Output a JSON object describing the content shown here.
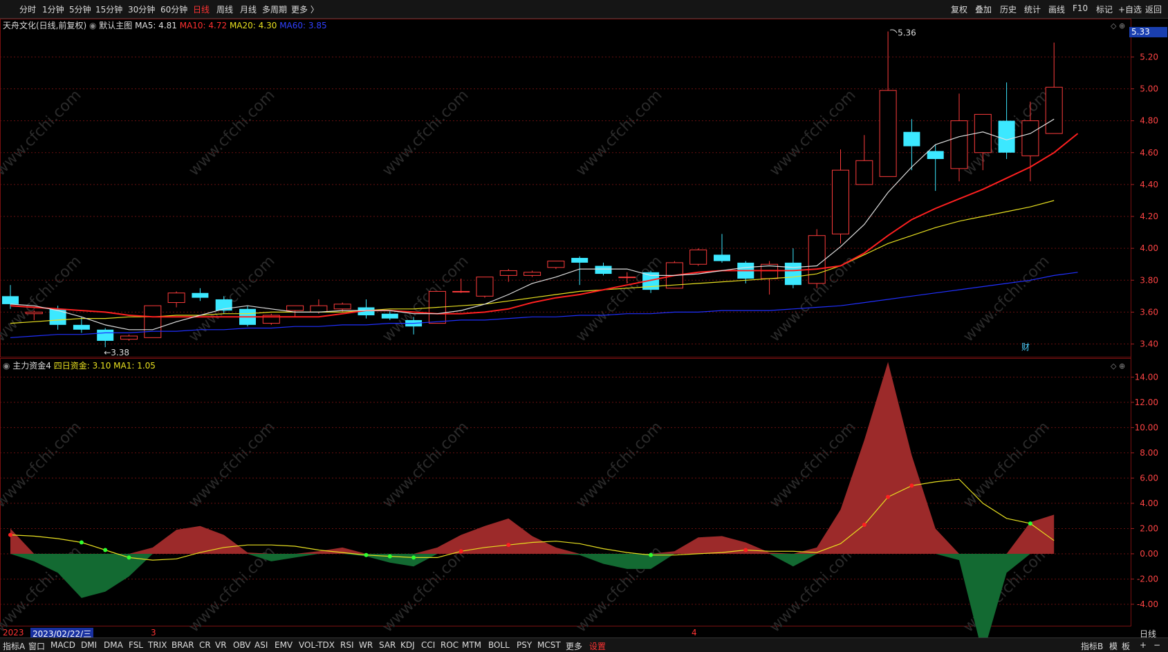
{
  "toolbar_left": [
    "分时",
    "1分钟",
    "5分钟",
    "15分钟",
    "30分钟",
    "60分钟",
    "日线",
    "周线",
    "月线",
    "多周期",
    "更多 〉"
  ],
  "toolbar_active": "日线",
  "toolbar_right": [
    "复权",
    "叠加",
    "历史",
    "统计",
    "画线",
    "F10",
    "标记",
    "+自选",
    "返回"
  ],
  "main_header": {
    "stock": "天舟文化(日线,前复权)",
    "template": "默认主图",
    "ma5": "MA5: 4.81",
    "ma10": "MA10: 4.72",
    "ma20": "MA20: 4.30",
    "ma60": "MA60: 3.85"
  },
  "sub_header": {
    "indicator": "主力资金4",
    "four_day": "四日资金: 3.10",
    "ma1": "MA1: 1.05"
  },
  "price_axis": [
    "5.20",
    "5.00",
    "4.80",
    "4.60",
    "4.40",
    "4.20",
    "4.00",
    "3.80",
    "3.60",
    "3.40"
  ],
  "price_tag": "5.33",
  "high_mark": "5.36",
  "low_mark": "3.38",
  "fin_badge": "财",
  "sub_axis": [
    "14.00",
    "12.00",
    "10.00",
    "8.00",
    "6.00",
    "4.00",
    "2.00",
    "0.00",
    "-2.00",
    "-4.00"
  ],
  "date_year": "2023",
  "date_cursor": "2023/02/22/三",
  "month3": "3",
  "month4": "4",
  "period_label": "日线",
  "watermark": "www.cfchi.com",
  "bottom_left": [
    "指标A",
    "窗口",
    "MACD",
    "DMI",
    "DMA",
    "FSL",
    "TRIX",
    "BRAR",
    "CR",
    "VR",
    "OBV",
    "ASI",
    "EMV",
    "VOL-TDX",
    "RSI",
    "WR",
    "SAR",
    "KDJ",
    "CCI",
    "ROC",
    "MTM",
    "BOLL",
    "PSY",
    "MCST",
    "更多",
    "设置"
  ],
  "bottom_right": [
    "指标B",
    "模",
    "板",
    "+",
    "−"
  ],
  "colors": {
    "up": "#ff3c3c",
    "down": "#3ce8ff",
    "ma5": "#e0e0e0",
    "ma10": "#ff2020",
    "ma20": "#e8e020",
    "ma60": "#2030ff",
    "grid": "#6a1010",
    "bg": "#000000"
  },
  "chart_data": {
    "type": "candlestick",
    "series_names": [
      "MA5",
      "MA10",
      "MA20",
      "MA60"
    ],
    "candles": [
      {
        "o": 3.7,
        "c": 3.65,
        "h": 3.77,
        "l": 3.62
      },
      {
        "o": 3.59,
        "c": 3.6,
        "h": 3.61,
        "l": 3.55
      },
      {
        "o": 3.62,
        "c": 3.52,
        "h": 3.64,
        "l": 3.49
      },
      {
        "o": 3.52,
        "c": 3.49,
        "h": 3.57,
        "l": 3.47
      },
      {
        "o": 3.49,
        "c": 3.42,
        "h": 3.5,
        "l": 3.38
      },
      {
        "o": 3.43,
        "c": 3.45,
        "h": 3.46,
        "l": 3.42
      },
      {
        "o": 3.44,
        "c": 3.64,
        "h": 3.64,
        "l": 3.44
      },
      {
        "o": 3.66,
        "c": 3.72,
        "h": 3.73,
        "l": 3.63
      },
      {
        "o": 3.72,
        "c": 3.69,
        "h": 3.75,
        "l": 3.67
      },
      {
        "o": 3.68,
        "c": 3.61,
        "h": 3.7,
        "l": 3.59
      },
      {
        "o": 3.62,
        "c": 3.52,
        "h": 3.64,
        "l": 3.51
      },
      {
        "o": 3.53,
        "c": 3.58,
        "h": 3.59,
        "l": 3.52
      },
      {
        "o": 3.61,
        "c": 3.64,
        "h": 3.64,
        "l": 3.57
      },
      {
        "o": 3.6,
        "c": 3.64,
        "h": 3.68,
        "l": 3.59
      },
      {
        "o": 3.62,
        "c": 3.65,
        "h": 3.66,
        "l": 3.6
      },
      {
        "o": 3.63,
        "c": 3.58,
        "h": 3.68,
        "l": 3.56
      },
      {
        "o": 3.59,
        "c": 3.56,
        "h": 3.61,
        "l": 3.55
      },
      {
        "o": 3.55,
        "c": 3.51,
        "h": 3.57,
        "l": 3.46
      },
      {
        "o": 3.53,
        "c": 3.73,
        "h": 3.73,
        "l": 3.53
      },
      {
        "o": 3.73,
        "c": 3.73,
        "h": 3.81,
        "l": 3.72
      },
      {
        "o": 3.7,
        "c": 3.82,
        "h": 3.82,
        "l": 3.69
      },
      {
        "o": 3.83,
        "c": 3.86,
        "h": 3.87,
        "l": 3.79
      },
      {
        "o": 3.83,
        "c": 3.85,
        "h": 3.86,
        "l": 3.82
      },
      {
        "o": 3.88,
        "c": 3.92,
        "h": 3.92,
        "l": 3.87
      },
      {
        "o": 3.94,
        "c": 3.91,
        "h": 3.95,
        "l": 3.77
      },
      {
        "o": 3.89,
        "c": 3.84,
        "h": 3.91,
        "l": 3.83
      },
      {
        "o": 3.82,
        "c": 3.82,
        "h": 3.85,
        "l": 3.78
      },
      {
        "o": 3.85,
        "c": 3.74,
        "h": 3.86,
        "l": 3.72
      },
      {
        "o": 3.75,
        "c": 3.91,
        "h": 3.92,
        "l": 3.75
      },
      {
        "o": 3.9,
        "c": 3.99,
        "h": 4.0,
        "l": 3.89
      },
      {
        "o": 3.96,
        "c": 3.92,
        "h": 4.09,
        "l": 3.91
      },
      {
        "o": 3.91,
        "c": 3.81,
        "h": 3.92,
        "l": 3.78
      },
      {
        "o": 3.81,
        "c": 3.9,
        "h": 3.92,
        "l": 3.71
      },
      {
        "o": 3.91,
        "c": 3.77,
        "h": 4.0,
        "l": 3.75
      },
      {
        "o": 3.78,
        "c": 4.08,
        "h": 4.12,
        "l": 3.75
      },
      {
        "o": 4.09,
        "c": 4.49,
        "h": 4.62,
        "l": 4.03
      },
      {
        "o": 4.4,
        "c": 4.55,
        "h": 4.71,
        "l": 4.4
      },
      {
        "o": 4.45,
        "c": 4.99,
        "h": 5.36,
        "l": 4.45
      },
      {
        "o": 4.73,
        "c": 4.64,
        "h": 4.81,
        "l": 4.49
      },
      {
        "o": 4.61,
        "c": 4.56,
        "h": 4.65,
        "l": 4.36
      },
      {
        "o": 4.5,
        "c": 4.8,
        "h": 4.97,
        "l": 4.42
      },
      {
        "o": 4.6,
        "c": 4.84,
        "h": 4.84,
        "l": 4.49
      },
      {
        "o": 4.8,
        "c": 4.6,
        "h": 5.04,
        "l": 4.56
      },
      {
        "o": 4.58,
        "c": 4.8,
        "h": 4.92,
        "l": 4.42
      },
      {
        "o": 4.72,
        "c": 5.01,
        "h": 5.29,
        "l": 4.72
      }
    ],
    "ma5": [
      3.65,
      3.64,
      3.61,
      3.57,
      3.52,
      3.49,
      3.49,
      3.54,
      3.58,
      3.62,
      3.64,
      3.62,
      3.6,
      3.6,
      3.61,
      3.61,
      3.61,
      3.59,
      3.59,
      3.61,
      3.65,
      3.71,
      3.78,
      3.82,
      3.87,
      3.87,
      3.87,
      3.83,
      3.83,
      3.84,
      3.86,
      3.88,
      3.89,
      3.88,
      3.89,
      4.01,
      4.15,
      4.35,
      4.51,
      4.65,
      4.7,
      4.73,
      4.68,
      4.72,
      4.81
    ],
    "ma10": [
      3.64,
      3.63,
      3.62,
      3.61,
      3.6,
      3.58,
      3.57,
      3.57,
      3.57,
      3.57,
      3.57,
      3.57,
      3.57,
      3.57,
      3.59,
      3.61,
      3.61,
      3.6,
      3.59,
      3.59,
      3.6,
      3.62,
      3.66,
      3.69,
      3.71,
      3.74,
      3.77,
      3.8,
      3.83,
      3.85,
      3.86,
      3.86,
      3.86,
      3.86,
      3.87,
      3.89,
      3.97,
      4.08,
      4.18,
      4.25,
      4.31,
      4.37,
      4.44,
      4.51,
      4.6,
      4.72
    ],
    "ma20": [
      3.53,
      3.54,
      3.55,
      3.56,
      3.56,
      3.57,
      3.57,
      3.58,
      3.58,
      3.59,
      3.59,
      3.6,
      3.6,
      3.6,
      3.6,
      3.61,
      3.62,
      3.62,
      3.63,
      3.64,
      3.65,
      3.67,
      3.69,
      3.71,
      3.73,
      3.74,
      3.75,
      3.76,
      3.77,
      3.78,
      3.79,
      3.8,
      3.81,
      3.82,
      3.84,
      3.89,
      3.96,
      4.03,
      4.08,
      4.13,
      4.17,
      4.2,
      4.23,
      4.26,
      4.3
    ],
    "ma60": [
      3.44,
      3.45,
      3.46,
      3.46,
      3.47,
      3.47,
      3.48,
      3.48,
      3.49,
      3.49,
      3.5,
      3.5,
      3.51,
      3.51,
      3.52,
      3.52,
      3.53,
      3.53,
      3.54,
      3.55,
      3.55,
      3.56,
      3.57,
      3.57,
      3.58,
      3.58,
      3.59,
      3.59,
      3.6,
      3.6,
      3.61,
      3.61,
      3.61,
      3.62,
      3.63,
      3.64,
      3.66,
      3.68,
      3.7,
      3.72,
      3.74,
      3.76,
      3.78,
      3.8,
      3.83,
      3.85
    ],
    "fund": [
      2.0,
      -0.6,
      -1.5,
      -3.5,
      -3.0,
      -1.8,
      0.5,
      1.9,
      2.2,
      1.5,
      0.1,
      -0.6,
      -0.3,
      0.2,
      0.5,
      -0.2,
      -0.7,
      -1.0,
      0.5,
      1.5,
      2.2,
      2.8,
      1.4,
      0.5,
      -0.1,
      -0.8,
      -1.2,
      -1.2,
      0.2,
      1.3,
      1.4,
      0.9,
      0.1,
      -1.0,
      0.5,
      3.5,
      9.0,
      15.2,
      7.8,
      2.0,
      -0.5,
      -8.0,
      -1.5,
      2.5,
      3.1
    ],
    "fund_ma": [
      1.5,
      1.4,
      1.2,
      0.9,
      0.3,
      -0.3,
      -0.5,
      -0.4,
      0.1,
      0.5,
      0.7,
      0.7,
      0.6,
      0.3,
      0.1,
      -0.1,
      -0.2,
      -0.3,
      -0.3,
      0.2,
      0.5,
      0.7,
      0.9,
      1.0,
      0.8,
      0.4,
      0.1,
      -0.1,
      -0.1,
      0.0,
      0.1,
      0.3,
      0.2,
      0.2,
      0.1,
      0.8,
      2.3,
      4.5,
      5.4,
      5.7,
      5.9,
      4.0,
      2.8,
      2.4,
      1.05
    ],
    "sub_ylim": [
      -5.7,
      15.5
    ],
    "price_ylim": [
      3.32,
      5.44
    ]
  }
}
